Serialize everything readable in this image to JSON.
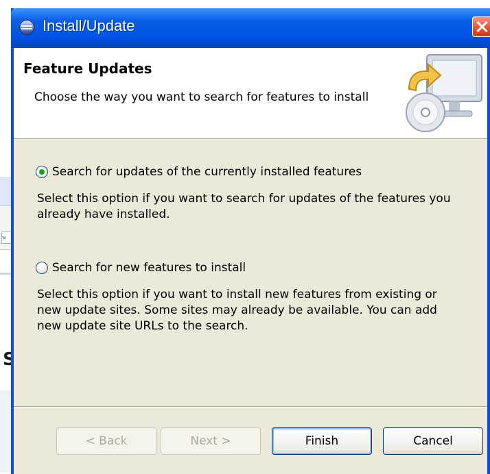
{
  "window": {
    "title": "Install/Update"
  },
  "header": {
    "title": "Feature Updates",
    "description": "Choose the way you want to search for features to install"
  },
  "options": [
    {
      "label": "Search for updates of the currently installed features",
      "description": "Select this option if you want to search for updates of the features you already have installed.",
      "selected": true
    },
    {
      "label": "Search for new features to install",
      "description": "Select this option if you want to install new features from existing or new update sites. Some sites may already be available. You can add new update site URLs to the search.",
      "selected": false
    }
  ],
  "buttons": {
    "back": "< Back",
    "next": "Next >",
    "finish": "Finish",
    "cancel": "Cancel"
  },
  "background": {
    "field_text": "w",
    "partial_heading": "S"
  },
  "colors": {
    "titlebar": "#0054e3",
    "dialog_bg": "#ece9d8",
    "radio_dot": "#21a121",
    "close_button": "#e3512b"
  }
}
